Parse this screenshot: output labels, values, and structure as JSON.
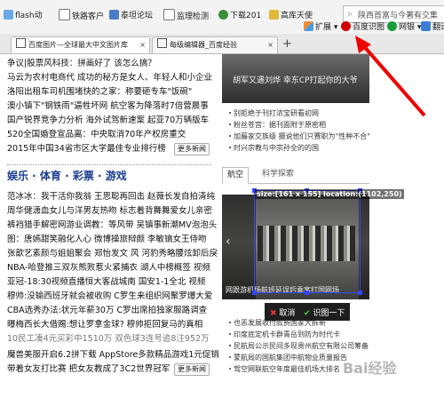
{
  "toolbar": {
    "items": [
      "flash动",
      "铁路客户",
      "泰坦论坛",
      "监理检测",
      "下载201",
      "高库天使"
    ],
    "right_items": [
      "扩展",
      "百度识图",
      "网银",
      "翻译"
    ],
    "search_text": "陕西首富与今著有交集"
  },
  "tabs": [
    {
      "label": "百度图片—全球最大中文图片库"
    },
    {
      "label": "每级编辑器_百度经验"
    }
  ],
  "headlines_top": [
    "争议|股票风科技：拼画好了 该怎么搞？",
    "马云为农村电商代 成功的秘方是女人、年轻人和小企业",
    "洛阳出租车司机围堵快的之家：称要砸专车\"饭碗\"",
    "澳小镇下\"钢铁雨\"逼牲坏网 航空客为降落时7倍营晨事",
    "国产锐界竞争力分析 海外试驾新速案 起亚70万辆版车",
    "520全国婚登宣品离：中央取消70年产权房重交",
    "2015年中国34省市区大学最佳专业排行榜"
  ],
  "more_label": "更多新闻",
  "section": {
    "title": "娱乐 · 体育 · 彩票 · 游戏"
  },
  "headlines_bottom": [
    "范冰冰：我干活你我翁 王思聪再回击 赵薇长发自拍清纯",
    "周华健潇血女儿与洋男友热吻 标志着背舞舞爱女儿亲密",
    "裤裆猎手解密网游业调教：等风带 吴镇事新潮MV泡泡头",
    "图：唐嫣甜笑融化人心 微博操旅辩颇 李敏镐女王侍吻",
    "张歆艺素颜与姐姐聚会 郑怡发文 风 河豹秀略腰炫卸后戾",
    "NBA-哈登推三双灰熊败惹火紧捕衣 湖人中榜概签 视频",
    "亚冠-18:30视频直播恒大客战城南 国安1-1全北 视频",
    "穆帅:没输西班牙就会被收购 C罗生来组织网聚罗爆大爱",
    "CBA选秀办法:状元年薪30万 C罗出席拍独家服路调查",
    "曝梅西长大借赐:想让罗拿金球? 穆帅拒回复马的真相",
    "10民工凑4元买彩中1510万 双色球3连号追8注952万",
    "魔兽美服开启6.2拼下载 AppStore多款精品游戏1元促销",
    "带着女友打比赛 把女友教成了3C2世界冠军"
  ],
  "panel": {
    "top_caption": "胡军又遇刘烨 幸东CP打起你的大爷",
    "tabs": [
      "航空",
      "科学探索"
    ],
    "selection_label": "size:[161 x 155] location:(1102,250)",
    "image_caption": "网跟游机场航班延误后乘客打国网场",
    "cancel": "取消",
    "recognize": "识图一下",
    "list_top": [
      "别拒绝于刊打浓宝研看初网",
      "粉丝苍宫：据刊面附于原密相",
      "加藤家交族级 摄说他们只赛职为\"性种不合\"",
      "时兴宗教与中宗孙全的的国"
    ],
    "list_bottom": [
      "也恶发展收付款费国家大拆新",
      "印度底定机卡群青岳到防为时代卡",
      "民航局公示民间多现贵州航空有限公司筹备",
      "蒙航局的国航集团中航物业质量报告",
      "驾空网联航空年度最佳机场大排名"
    ]
  },
  "watermark": "Bai经验",
  "colors": {
    "accent": "#d00000",
    "green": "#2a9d2a",
    "selection": "#3344ff"
  }
}
